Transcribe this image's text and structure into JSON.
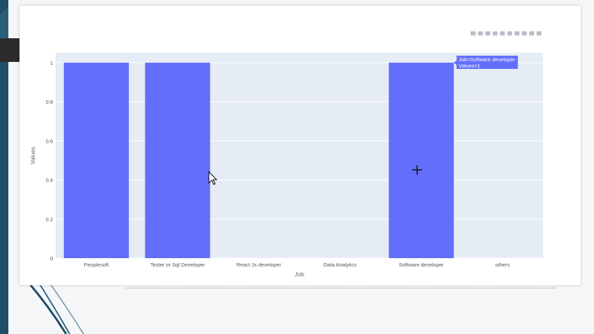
{
  "colors": {
    "bar": "#636efa",
    "plot_bg": "#e5ecf6",
    "grid": "#ffffff",
    "tooltip_bg": "#636efa",
    "backdrop_dark": "#1f4e66",
    "backdrop_mid": "#6f8ea0"
  },
  "toolbar": {
    "icons": [
      "camera-icon",
      "zoom-icon",
      "pan-icon",
      "box-select-icon",
      "lasso-icon",
      "zoom-in-icon",
      "zoom-out-icon",
      "autoscale-icon",
      "reset-axes-icon",
      "plotly-logo-icon"
    ]
  },
  "chart_data": {
    "type": "bar",
    "categories": [
      "Peoplesoft",
      "Tester or Sql Developer",
      "React Js developer",
      "Data Analytics",
      "Software developer",
      "others"
    ],
    "values": [
      1,
      1,
      0,
      0,
      1,
      0
    ],
    "xlabel": "Job",
    "ylabel": "Values",
    "ylim": [
      0,
      1.05
    ],
    "yticks": [
      0,
      0.2,
      0.4,
      0.6,
      0.8,
      1
    ],
    "ytick_labels": [
      "0",
      "0.2",
      "0.4",
      "0.6",
      "0.8",
      "1"
    ],
    "grid": true,
    "tooltip": {
      "category": "Software developer",
      "lines": [
        "Job=Software developer",
        "Values=1"
      ]
    }
  }
}
